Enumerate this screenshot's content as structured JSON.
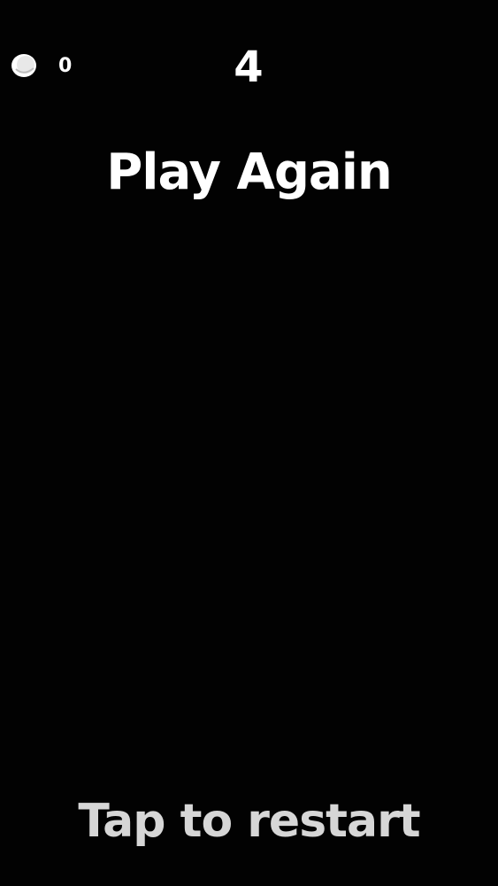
{
  "hud": {
    "coin_icon": "coin-icon",
    "coin_count": "0",
    "score": "4"
  },
  "buttons": {
    "play_again": "Play Again",
    "tap_to_restart": "Tap to restart"
  },
  "colors": {
    "background": "#020202",
    "text_primary": "#ffffff",
    "text_secondary": "#d6d6d6"
  }
}
